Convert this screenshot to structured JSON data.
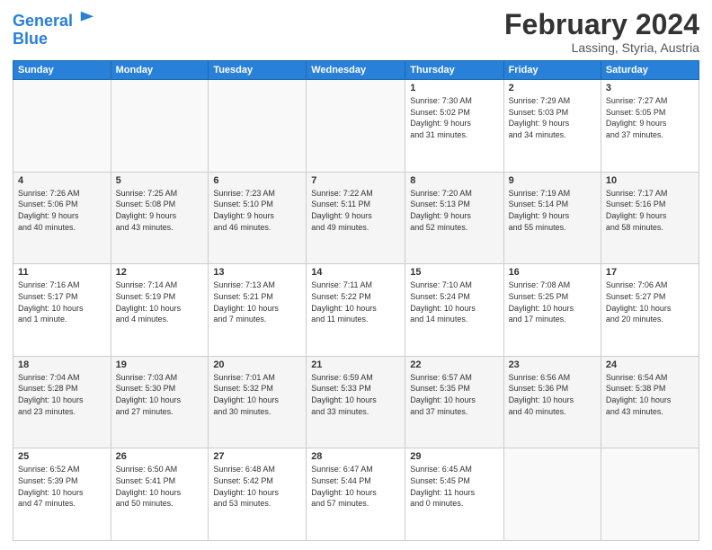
{
  "header": {
    "logo_line1": "General",
    "logo_line2": "Blue",
    "main_title": "February 2024",
    "subtitle": "Lassing, Styria, Austria"
  },
  "calendar": {
    "days_of_week": [
      "Sunday",
      "Monday",
      "Tuesday",
      "Wednesday",
      "Thursday",
      "Friday",
      "Saturday"
    ],
    "weeks": [
      [
        {
          "day": "",
          "info": ""
        },
        {
          "day": "",
          "info": ""
        },
        {
          "day": "",
          "info": ""
        },
        {
          "day": "",
          "info": ""
        },
        {
          "day": "1",
          "info": "Sunrise: 7:30 AM\nSunset: 5:02 PM\nDaylight: 9 hours\nand 31 minutes."
        },
        {
          "day": "2",
          "info": "Sunrise: 7:29 AM\nSunset: 5:03 PM\nDaylight: 9 hours\nand 34 minutes."
        },
        {
          "day": "3",
          "info": "Sunrise: 7:27 AM\nSunset: 5:05 PM\nDaylight: 9 hours\nand 37 minutes."
        }
      ],
      [
        {
          "day": "4",
          "info": "Sunrise: 7:26 AM\nSunset: 5:06 PM\nDaylight: 9 hours\nand 40 minutes."
        },
        {
          "day": "5",
          "info": "Sunrise: 7:25 AM\nSunset: 5:08 PM\nDaylight: 9 hours\nand 43 minutes."
        },
        {
          "day": "6",
          "info": "Sunrise: 7:23 AM\nSunset: 5:10 PM\nDaylight: 9 hours\nand 46 minutes."
        },
        {
          "day": "7",
          "info": "Sunrise: 7:22 AM\nSunset: 5:11 PM\nDaylight: 9 hours\nand 49 minutes."
        },
        {
          "day": "8",
          "info": "Sunrise: 7:20 AM\nSunset: 5:13 PM\nDaylight: 9 hours\nand 52 minutes."
        },
        {
          "day": "9",
          "info": "Sunrise: 7:19 AM\nSunset: 5:14 PM\nDaylight: 9 hours\nand 55 minutes."
        },
        {
          "day": "10",
          "info": "Sunrise: 7:17 AM\nSunset: 5:16 PM\nDaylight: 9 hours\nand 58 minutes."
        }
      ],
      [
        {
          "day": "11",
          "info": "Sunrise: 7:16 AM\nSunset: 5:17 PM\nDaylight: 10 hours\nand 1 minute."
        },
        {
          "day": "12",
          "info": "Sunrise: 7:14 AM\nSunset: 5:19 PM\nDaylight: 10 hours\nand 4 minutes."
        },
        {
          "day": "13",
          "info": "Sunrise: 7:13 AM\nSunset: 5:21 PM\nDaylight: 10 hours\nand 7 minutes."
        },
        {
          "day": "14",
          "info": "Sunrise: 7:11 AM\nSunset: 5:22 PM\nDaylight: 10 hours\nand 11 minutes."
        },
        {
          "day": "15",
          "info": "Sunrise: 7:10 AM\nSunset: 5:24 PM\nDaylight: 10 hours\nand 14 minutes."
        },
        {
          "day": "16",
          "info": "Sunrise: 7:08 AM\nSunset: 5:25 PM\nDaylight: 10 hours\nand 17 minutes."
        },
        {
          "day": "17",
          "info": "Sunrise: 7:06 AM\nSunset: 5:27 PM\nDaylight: 10 hours\nand 20 minutes."
        }
      ],
      [
        {
          "day": "18",
          "info": "Sunrise: 7:04 AM\nSunset: 5:28 PM\nDaylight: 10 hours\nand 23 minutes."
        },
        {
          "day": "19",
          "info": "Sunrise: 7:03 AM\nSunset: 5:30 PM\nDaylight: 10 hours\nand 27 minutes."
        },
        {
          "day": "20",
          "info": "Sunrise: 7:01 AM\nSunset: 5:32 PM\nDaylight: 10 hours\nand 30 minutes."
        },
        {
          "day": "21",
          "info": "Sunrise: 6:59 AM\nSunset: 5:33 PM\nDaylight: 10 hours\nand 33 minutes."
        },
        {
          "day": "22",
          "info": "Sunrise: 6:57 AM\nSunset: 5:35 PM\nDaylight: 10 hours\nand 37 minutes."
        },
        {
          "day": "23",
          "info": "Sunrise: 6:56 AM\nSunset: 5:36 PM\nDaylight: 10 hours\nand 40 minutes."
        },
        {
          "day": "24",
          "info": "Sunrise: 6:54 AM\nSunset: 5:38 PM\nDaylight: 10 hours\nand 43 minutes."
        }
      ],
      [
        {
          "day": "25",
          "info": "Sunrise: 6:52 AM\nSunset: 5:39 PM\nDaylight: 10 hours\nand 47 minutes."
        },
        {
          "day": "26",
          "info": "Sunrise: 6:50 AM\nSunset: 5:41 PM\nDaylight: 10 hours\nand 50 minutes."
        },
        {
          "day": "27",
          "info": "Sunrise: 6:48 AM\nSunset: 5:42 PM\nDaylight: 10 hours\nand 53 minutes."
        },
        {
          "day": "28",
          "info": "Sunrise: 6:47 AM\nSunset: 5:44 PM\nDaylight: 10 hours\nand 57 minutes."
        },
        {
          "day": "29",
          "info": "Sunrise: 6:45 AM\nSunset: 5:45 PM\nDaylight: 11 hours\nand 0 minutes."
        },
        {
          "day": "",
          "info": ""
        },
        {
          "day": "",
          "info": ""
        }
      ]
    ]
  }
}
